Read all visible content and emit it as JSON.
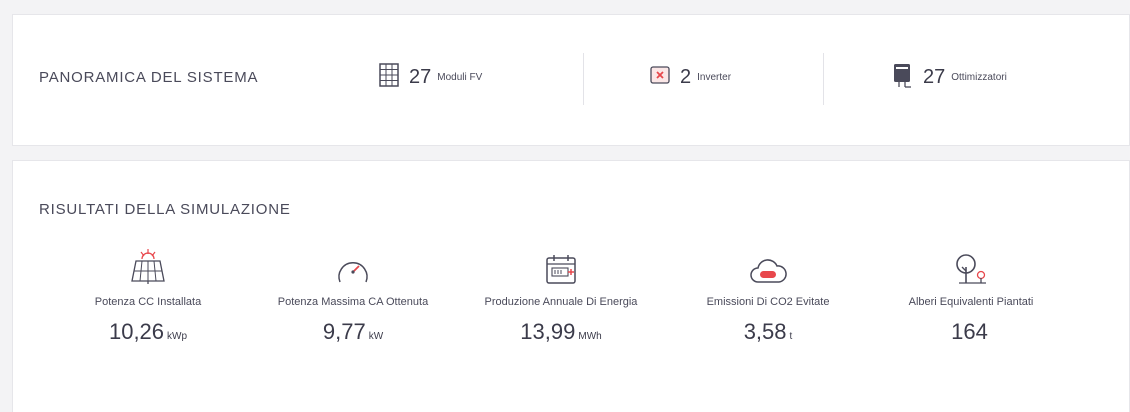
{
  "overview": {
    "title": "PANORAMICA DEL SISTEMA",
    "items": [
      {
        "count": "27",
        "label": "Moduli FV",
        "icon": "solar-module-icon"
      },
      {
        "count": "2",
        "label": "Inverter",
        "icon": "inverter-icon"
      },
      {
        "count": "27",
        "label": "Ottimizzatori",
        "icon": "optimizer-icon"
      }
    ]
  },
  "results": {
    "title": "RISULTATI DELLA SIMULAZIONE",
    "metrics": [
      {
        "label": "Potenza CC Installata",
        "value": "10,26",
        "unit": "kWp",
        "icon": "solar-panel-sun-icon"
      },
      {
        "label": "Potenza Massima CA Ottenuta",
        "value": "9,77",
        "unit": "kW",
        "icon": "gauge-icon"
      },
      {
        "label": "Produzione Annuale Di Energia",
        "value": "13,99",
        "unit": "MWh",
        "icon": "calendar-battery-icon"
      },
      {
        "label": "Emissioni Di CO2 Evitate",
        "value": "3,58",
        "unit": "t",
        "icon": "co2-cloud-icon"
      },
      {
        "label": "Alberi Equivalenti Piantati",
        "value": "164",
        "unit": "",
        "icon": "trees-icon"
      }
    ]
  },
  "colors": {
    "accent": "#e8474c",
    "text": "#3b3b4a",
    "icon": "#4a4a5a"
  }
}
